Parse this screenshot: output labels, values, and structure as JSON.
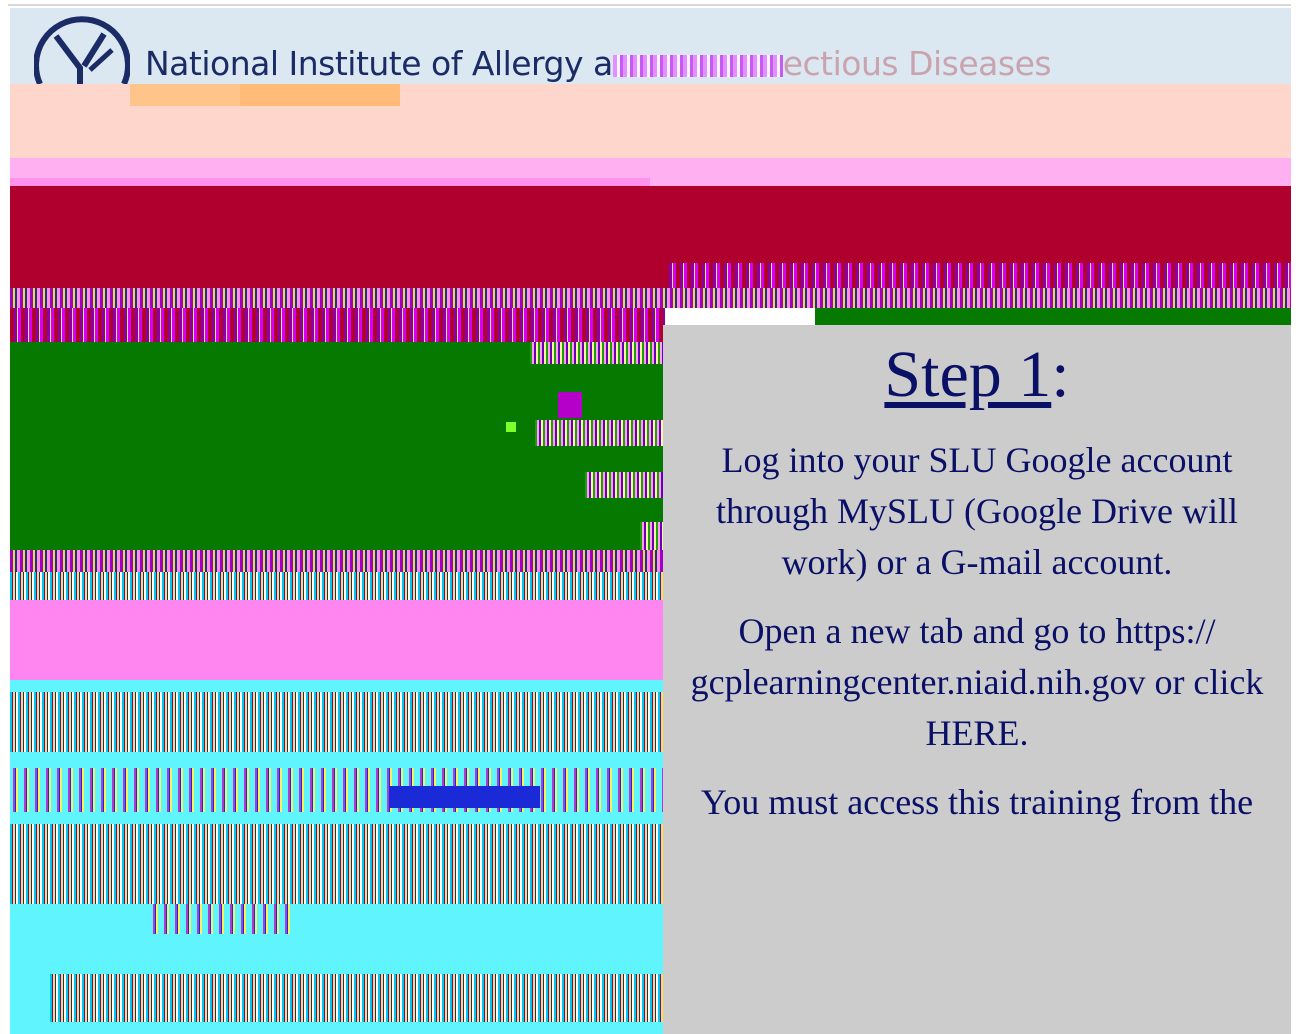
{
  "header": {
    "org_name_visible": "National Institute of Allergy a",
    "org_name_faded": "ectious Diseases",
    "logo_icon": "niaid-logo-icon"
  },
  "panel": {
    "title": "Step 1",
    "title_suffix": ":",
    "paragraph_1": "Log into your SLU Google account through MySLU (Google Drive will work) or a G-mail account.",
    "paragraph_2": "Open a new tab and go to https:// gcplearningcenter.niaid.nih.gov or click HERE.",
    "paragraph_3": "You must access this training from the"
  },
  "colors": {
    "panel_bg": "#cccccc",
    "panel_text": "#0a1066",
    "banner_red": "#b0002e",
    "banner_green": "#067a00",
    "banner_pink": "#ff86f0",
    "banner_cyan": "#60f4ff",
    "banner_peach": "#ffd6cc"
  }
}
